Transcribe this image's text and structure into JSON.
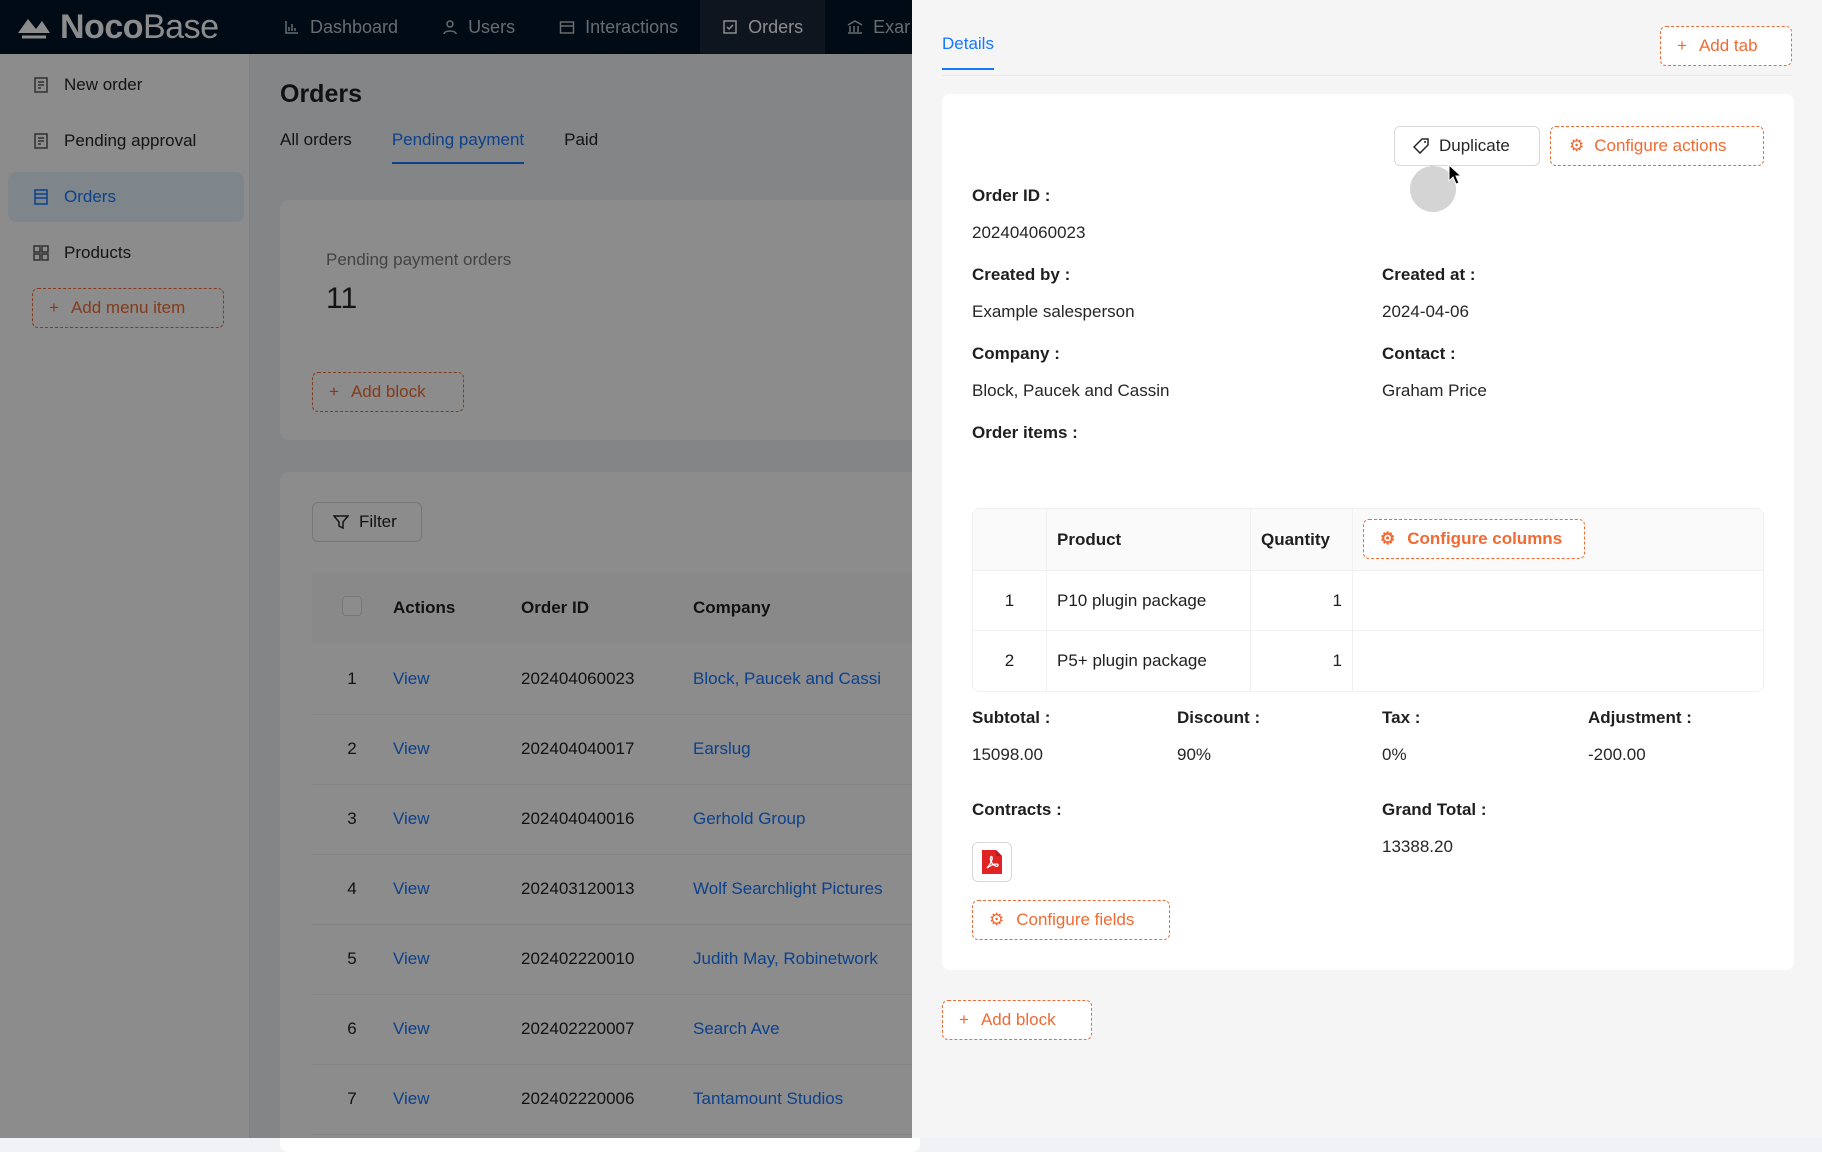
{
  "brand": {
    "name_bold": "Noco",
    "name_light": "Base"
  },
  "nav": [
    {
      "label": "Dashboard",
      "icon": "chart-icon"
    },
    {
      "label": "Users",
      "icon": "user-icon"
    },
    {
      "label": "Interactions",
      "icon": "calendar-icon"
    },
    {
      "label": "Orders",
      "icon": "order-icon",
      "active": true
    },
    {
      "label": "Exar",
      "icon": "bank-icon"
    }
  ],
  "sidebar": {
    "items": [
      {
        "label": "New order",
        "icon": "form-icon"
      },
      {
        "label": "Pending approval",
        "icon": "form-icon"
      },
      {
        "label": "Orders",
        "icon": "table-icon",
        "active": true
      },
      {
        "label": "Products",
        "icon": "grid-icon"
      }
    ],
    "add_menu_label": "Add menu item"
  },
  "main": {
    "title": "Orders",
    "tabs": [
      {
        "label": "All orders"
      },
      {
        "label": "Pending payment",
        "active": true
      },
      {
        "label": "Paid"
      }
    ],
    "stat": {
      "title": "Pending payment orders",
      "value": "11"
    },
    "add_block_label": "Add block",
    "filter_label": "Filter",
    "table": {
      "headers": [
        "Actions",
        "Order ID",
        "Company"
      ],
      "rows": [
        {
          "index": "1",
          "action": "View",
          "order_id": "202404060023",
          "company": "Block, Paucek and Cassi"
        },
        {
          "index": "2",
          "action": "View",
          "order_id": "202404040017",
          "company": "Earslug"
        },
        {
          "index": "3",
          "action": "View",
          "order_id": "202404040016",
          "company": "Gerhold Group"
        },
        {
          "index": "4",
          "action": "View",
          "order_id": "202403120013",
          "company": "Wolf Searchlight Pictures"
        },
        {
          "index": "5",
          "action": "View",
          "order_id": "202402220010",
          "company": "Judith May, Robinetwork"
        },
        {
          "index": "6",
          "action": "View",
          "order_id": "202402220007",
          "company": "Search Ave"
        },
        {
          "index": "7",
          "action": "View",
          "order_id": "202402220006",
          "company": "Tantamount Studios"
        }
      ]
    }
  },
  "drawer": {
    "tab": "Details",
    "add_tab_label": "Add tab",
    "duplicate_label": "Duplicate",
    "configure_actions_label": "Configure actions",
    "fields": {
      "order_id_label": "Order ID",
      "order_id": "202404060023",
      "created_by_label": "Created by",
      "created_by": "Example salesperson",
      "created_at_label": "Created at",
      "created_at": "2024-04-06",
      "company_label": "Company",
      "company": "Block, Paucek and Cassin",
      "contact_label": "Contact",
      "contact": "Graham Price",
      "order_items_label": "Order items",
      "subtotal_label": "Subtotal",
      "subtotal": "15098.00",
      "discount_label": "Discount",
      "discount": "90%",
      "tax_label": "Tax",
      "tax": "0%",
      "adjustment_label": "Adjustment",
      "adjustment": "-200.00",
      "contracts_label": "Contracts",
      "grand_total_label": "Grand Total",
      "grand_total": "13388.20"
    },
    "items_table": {
      "headers": [
        "Product",
        "Quantity"
      ],
      "configure_columns_label": "Configure columns",
      "rows": [
        {
          "index": "1",
          "product": "P10 plugin package",
          "quantity": "1"
        },
        {
          "index": "2",
          "product": "P5+ plugin package",
          "quantity": "1"
        }
      ]
    },
    "configure_fields_label": "Configure fields",
    "add_block_label": "Add block"
  },
  "colors": {
    "primary": "#1677ff",
    "accent": "#f06a33",
    "nav_bg": "#001529"
  }
}
